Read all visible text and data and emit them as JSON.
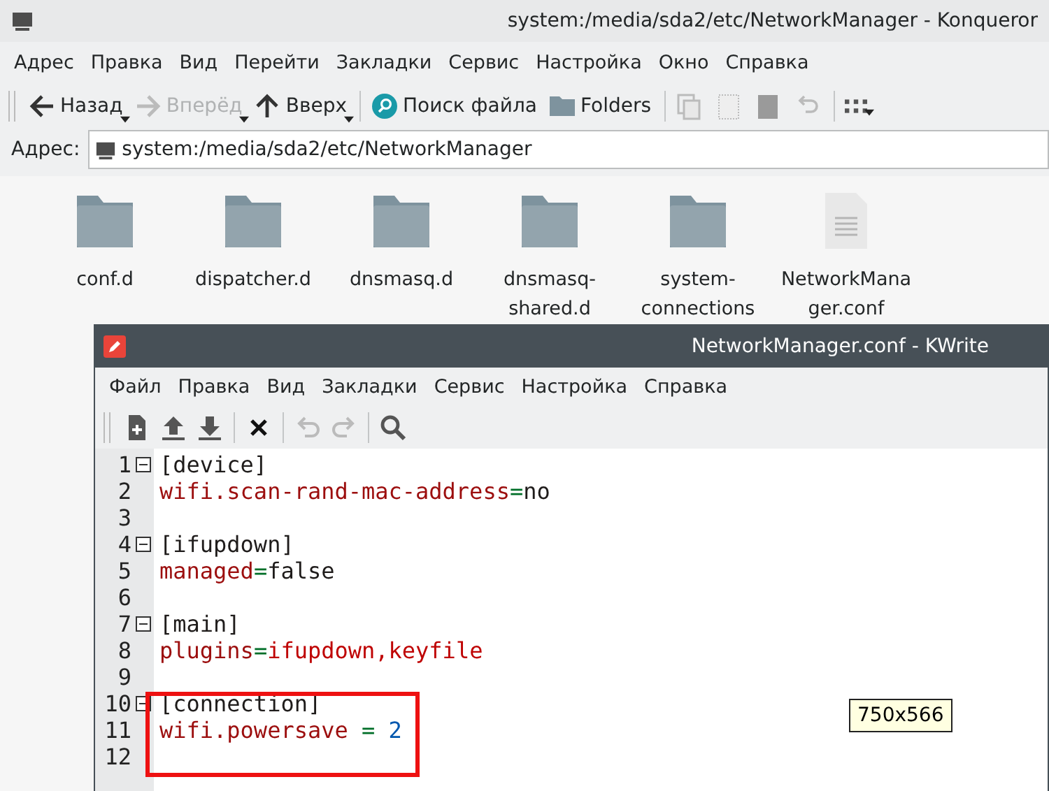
{
  "konqueror": {
    "title": "system:/media/sda2/etc/NetworkManager - Konqueror",
    "menu": [
      "Адрес",
      "Правка",
      "Вид",
      "Перейти",
      "Закладки",
      "Сервис",
      "Настройка",
      "Окно",
      "Справка"
    ],
    "toolbar": [
      {
        "kind": "back",
        "label": "Назад",
        "disabled": false,
        "dropdown": true
      },
      {
        "kind": "forward",
        "label": "Вперёд",
        "disabled": true,
        "dropdown": true
      },
      {
        "kind": "up",
        "label": "Вверх",
        "disabled": false,
        "dropdown": true
      },
      {
        "kind": "separator"
      },
      {
        "kind": "search",
        "label": "Поиск файла",
        "disabled": false,
        "dropdown": false
      },
      {
        "kind": "folders",
        "label": "Folders",
        "disabled": false,
        "dropdown": false
      },
      {
        "kind": "separator"
      },
      {
        "kind": "copy",
        "disabled": true,
        "dropdown": false
      },
      {
        "kind": "paste",
        "disabled": true,
        "dropdown": false
      },
      {
        "kind": "trash",
        "disabled": true,
        "dropdown": false
      },
      {
        "kind": "undo",
        "disabled": true,
        "dropdown": false
      },
      {
        "kind": "separator"
      },
      {
        "kind": "grid",
        "disabled": false,
        "dropdown": true
      }
    ],
    "address_label": "Адрес:",
    "address": "system:/media/sda2/etc/NetworkManager",
    "files": [
      {
        "kind": "folder",
        "name": "conf.d"
      },
      {
        "kind": "folder",
        "name": "dispatcher.d"
      },
      {
        "kind": "folder",
        "name": "dnsmasq.d"
      },
      {
        "kind": "folder",
        "name": "dnsmasq-shared.d"
      },
      {
        "kind": "folder",
        "name": "system-connections"
      },
      {
        "kind": "file",
        "name": "NetworkManager.conf"
      }
    ]
  },
  "kwrite": {
    "title": "NetworkManager.conf - KWrite",
    "menu": [
      "Файл",
      "Правка",
      "Вид",
      "Закладки",
      "Сервис",
      "Настройка",
      "Справка"
    ],
    "toolbar": [
      {
        "kind": "new",
        "disabled": false
      },
      {
        "kind": "open",
        "disabled": false
      },
      {
        "kind": "save",
        "disabled": false
      },
      {
        "kind": "separator"
      },
      {
        "kind": "close",
        "disabled": false
      },
      {
        "kind": "separator"
      },
      {
        "kind": "undo",
        "disabled": true
      },
      {
        "kind": "redo",
        "disabled": true
      },
      {
        "kind": "separator"
      },
      {
        "kind": "find",
        "disabled": false
      }
    ],
    "lines": [
      {
        "number": "1",
        "fold": true,
        "highlighted": false,
        "tokens": [
          {
            "kind": "section",
            "text": "[device]"
          }
        ]
      },
      {
        "number": "2",
        "fold": false,
        "highlighted": false,
        "tokens": [
          {
            "kind": "key",
            "text": "wifi.scan-rand-mac-address"
          },
          {
            "kind": "op",
            "text": "="
          },
          {
            "kind": "value",
            "text": "no"
          }
        ]
      },
      {
        "number": "3",
        "fold": false,
        "highlighted": false
      },
      {
        "number": "4",
        "fold": true,
        "highlighted": false,
        "tokens": [
          {
            "kind": "section",
            "text": "[ifupdown]"
          }
        ]
      },
      {
        "number": "5",
        "fold": false,
        "highlighted": false,
        "tokens": [
          {
            "kind": "key",
            "text": "managed"
          },
          {
            "kind": "op",
            "text": "="
          },
          {
            "kind": "value",
            "text": "false"
          }
        ]
      },
      {
        "number": "6",
        "fold": false,
        "highlighted": false
      },
      {
        "number": "7",
        "fold": true,
        "highlighted": false,
        "tokens": [
          {
            "kind": "section",
            "text": "[main]"
          }
        ]
      },
      {
        "number": "8",
        "fold": false,
        "highlighted": false,
        "tokens": [
          {
            "kind": "key",
            "text": "plugins"
          },
          {
            "kind": "op",
            "text": "="
          },
          {
            "kind": "string",
            "text": "ifupdown,keyfile"
          }
        ]
      },
      {
        "number": "9",
        "fold": false,
        "highlighted": false
      },
      {
        "number": "10",
        "fold": true,
        "highlighted": true,
        "tokens": [
          {
            "kind": "section",
            "text": "[connection]"
          }
        ]
      },
      {
        "number": "11",
        "fold": false,
        "highlighted": true,
        "tokens": [
          {
            "kind": "key",
            "text": "wifi.powersave "
          },
          {
            "kind": "op",
            "text": "= "
          },
          {
            "kind": "number",
            "text": "2"
          }
        ]
      },
      {
        "number": "12",
        "fold": false,
        "highlighted": true
      }
    ]
  },
  "tooltip": "750x566"
}
